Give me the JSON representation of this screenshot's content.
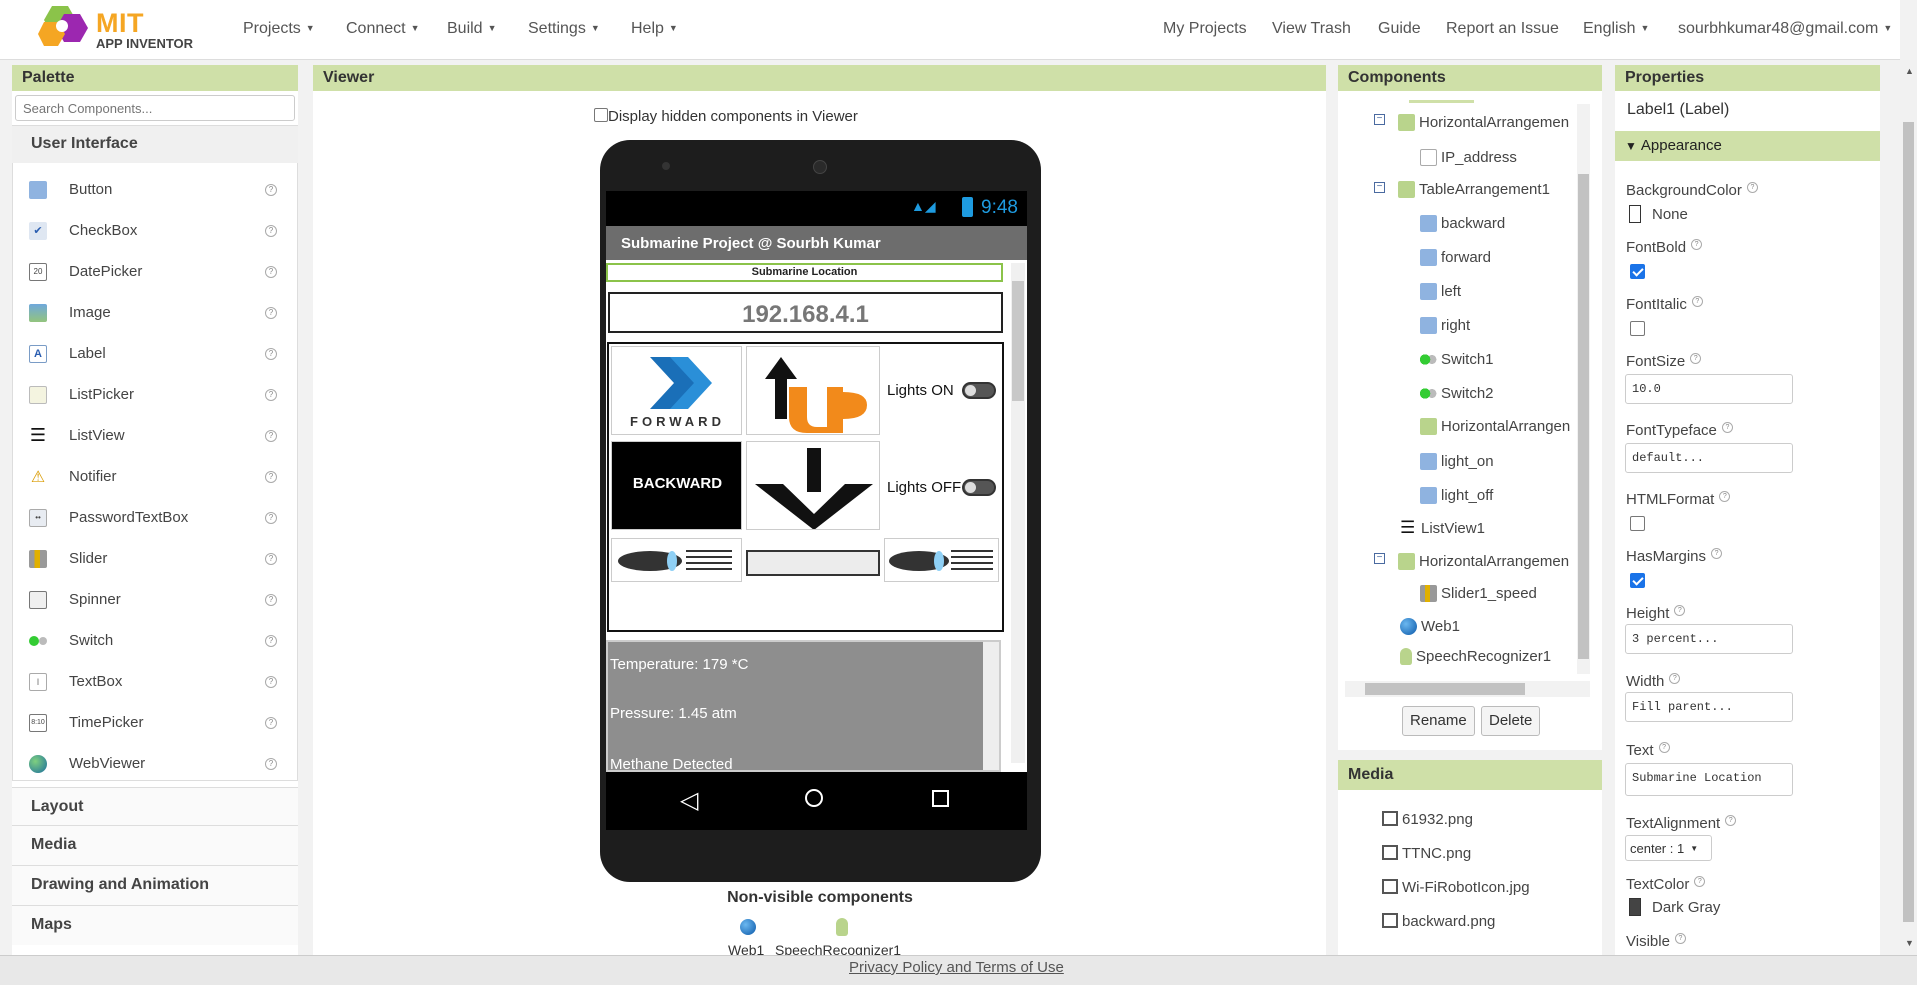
{
  "brand": {
    "line1": "MIT",
    "line2": "APP INVENTOR"
  },
  "nav": {
    "left": [
      "Projects",
      "Connect",
      "Build",
      "Settings",
      "Help"
    ],
    "right": [
      "My Projects",
      "View Trash",
      "Guide",
      "Report an Issue",
      "English",
      "sourbhkumar48@gmail.com"
    ]
  },
  "palette": {
    "title": "Palette",
    "search_placeholder": "Search Components...",
    "category_open": "User Interface",
    "items": [
      "Button",
      "CheckBox",
      "DatePicker",
      "Image",
      "Label",
      "ListPicker",
      "ListView",
      "Notifier",
      "PasswordTextBox",
      "Slider",
      "Spinner",
      "Switch",
      "TextBox",
      "TimePicker",
      "WebViewer"
    ],
    "categories": [
      "Layout",
      "Media",
      "Drawing and Animation",
      "Maps"
    ]
  },
  "viewer": {
    "title": "Viewer",
    "hidden_checkbox_label": "Display hidden components in Viewer",
    "status_time": "9:48",
    "app_title": "Submarine Project @ Sourbh Kumar",
    "label1": "Submarine Location",
    "ip": "192.168.4.1",
    "lights_on": "Lights ON",
    "lights_off": "Lights OFF",
    "forward_img_text": "FORWARD",
    "backward_img_text": "BACKWARD",
    "list": [
      "Temperature: 179 *C",
      "Pressure: 1.45 atm",
      "Methane Detected"
    ],
    "nonvisible_title": "Non-visible components",
    "nonvisible": [
      "Web1",
      "SpeechRecognizer1"
    ]
  },
  "components": {
    "title": "Components",
    "tree": [
      "HorizontalArrangemen",
      "IP_address",
      "TableArrangement1",
      "backward",
      "forward",
      "left",
      "right",
      "Switch1",
      "Switch2",
      "HorizontalArrangen",
      "light_on",
      "light_off",
      "ListView1",
      "HorizontalArrangemen",
      "Slider1_speed",
      "Web1",
      "SpeechRecognizer1"
    ],
    "rename": "Rename",
    "delete": "Delete"
  },
  "media": {
    "title": "Media",
    "files": [
      "61932.png",
      "TTNC.png",
      "Wi-FiRobotIcon.jpg",
      "backward.png"
    ]
  },
  "properties": {
    "title": "Properties",
    "component": "Label1 (Label)",
    "section": "Appearance",
    "bg_label": "BackgroundColor",
    "bg_value": "None",
    "fontbold_label": "FontBold",
    "fontitalic_label": "FontItalic",
    "fontsize_label": "FontSize",
    "fontsize_value": "10.0",
    "fonttypeface_label": "FontTypeface",
    "fonttypeface_value": "default...",
    "htmlformat_label": "HTMLFormat",
    "hasmargins_label": "HasMargins",
    "height_label": "Height",
    "height_value": "3 percent...",
    "width_label": "Width",
    "width_value": "Fill parent...",
    "text_label": "Text",
    "text_value": "Submarine Location",
    "textalign_label": "TextAlignment",
    "textalign_value": "center : 1",
    "textcolor_label": "TextColor",
    "textcolor_value": "Dark Gray",
    "visible_label": "Visible"
  },
  "footer": {
    "link": "Privacy Policy and Terms of Use"
  }
}
